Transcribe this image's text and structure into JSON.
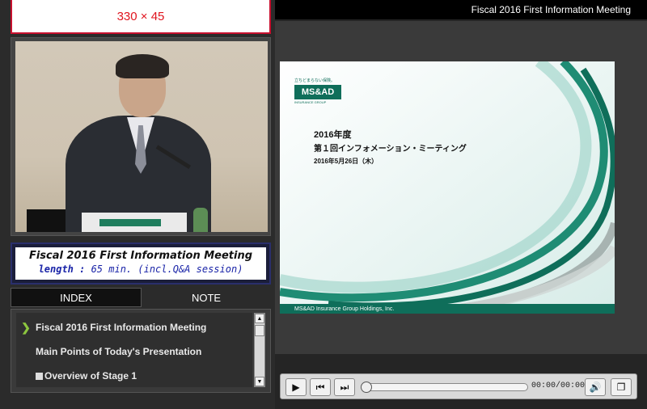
{
  "banner": {
    "text": "330 × 45"
  },
  "title_panel": {
    "title": "Fiscal 2016 First Information Meeting",
    "length_label": "length :",
    "length_value": " 65 min. (incl.Q&A session)"
  },
  "tabs": [
    {
      "label": "INDEX"
    },
    {
      "label": "NOTE"
    }
  ],
  "index_items": [
    {
      "label": "Fiscal 2016 First Information Meeting",
      "active": true
    },
    {
      "label": "Main Points of Today's Presentation"
    },
    {
      "label": "Overview of Stage 1"
    }
  ],
  "header": {
    "title": "Fiscal 2016 First Information Meeting"
  },
  "slide": {
    "logo_tag": "立ちどまらない保険。",
    "logo_main": "MS&AD",
    "logo_sub": "INSURANCE GROUP",
    "line1": "2016年度",
    "line2": "第１回インフォメーション・ミーティング",
    "line3": "2016年5月26日（木）",
    "footer": "MS&AD Insurance Group Holdings, Inc."
  },
  "player": {
    "time": "00:00/00:00",
    "progress": 0
  },
  "colors": {
    "accent": "#0f6e5a",
    "banner_red": "#e0141e",
    "chevron": "#8cc63f"
  },
  "icons": {
    "play": "play-icon",
    "prev": "skip-back-icon",
    "next": "skip-forward-icon",
    "volume": "volume-icon",
    "window": "window-icon"
  }
}
